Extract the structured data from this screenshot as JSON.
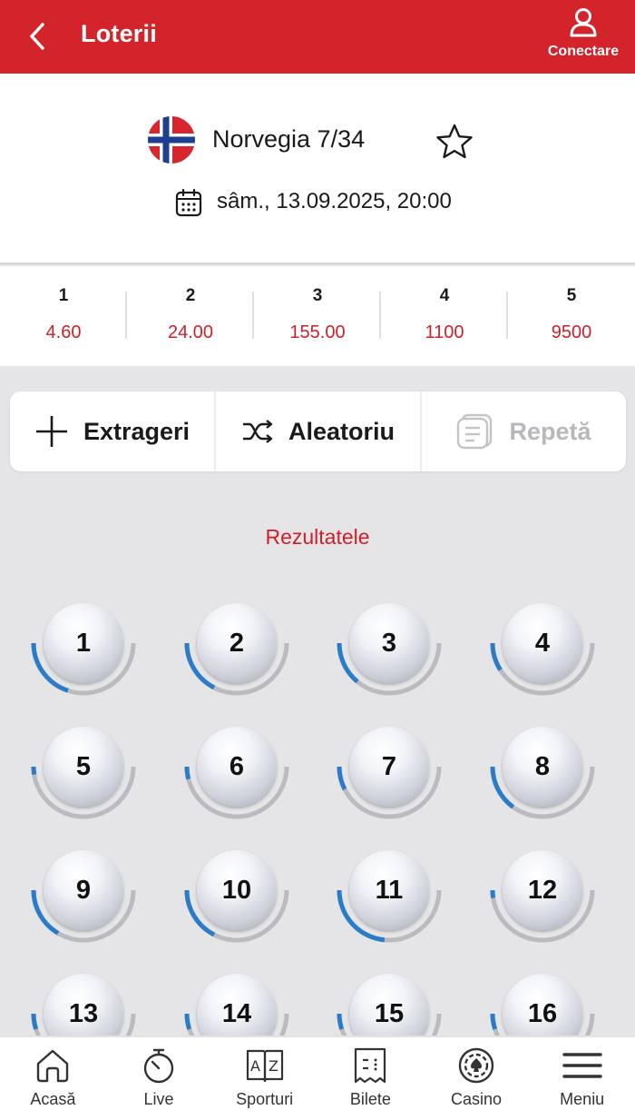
{
  "topbar": {
    "title": "Loterii",
    "login_label": "Conectare"
  },
  "lottery": {
    "name": "Norvegia 7/34",
    "draw_datetime": "sâm., 13.09.2025, 20:00"
  },
  "odds": [
    {
      "hits": "1",
      "value": "4.60"
    },
    {
      "hits": "2",
      "value": "24.00"
    },
    {
      "hits": "3",
      "value": "155.00"
    },
    {
      "hits": "4",
      "value": "1100"
    },
    {
      "hits": "5",
      "value": "9500"
    }
  ],
  "actions": {
    "draws": "Extrageri",
    "random": "Aleatoriu",
    "repeat": "Repetă"
  },
  "results_label": "Rezultatele",
  "balls": [
    {
      "number": "1",
      "frequency": 0.4
    },
    {
      "number": "2",
      "frequency": 0.35
    },
    {
      "number": "3",
      "frequency": 0.28
    },
    {
      "number": "4",
      "frequency": 0.18
    },
    {
      "number": "5",
      "frequency": 0.05
    },
    {
      "number": "6",
      "frequency": 0.08
    },
    {
      "number": "7",
      "frequency": 0.15
    },
    {
      "number": "8",
      "frequency": 0.3
    },
    {
      "number": "9",
      "frequency": 0.33
    },
    {
      "number": "10",
      "frequency": 0.35
    },
    {
      "number": "11",
      "frequency": 0.47
    },
    {
      "number": "12",
      "frequency": 0.05
    },
    {
      "number": "13",
      "frequency": 0.1
    },
    {
      "number": "14",
      "frequency": 0.1
    },
    {
      "number": "15",
      "frequency": 0.1
    },
    {
      "number": "16",
      "frequency": 0.1
    }
  ],
  "nav": [
    {
      "label": "Acasă",
      "icon": "home-icon"
    },
    {
      "label": "Live",
      "icon": "stopwatch-icon"
    },
    {
      "label": "Sporturi",
      "icon": "az-book-icon"
    },
    {
      "label": "Bilete",
      "icon": "ticket-icon"
    },
    {
      "label": "Casino",
      "icon": "casino-chip-icon"
    },
    {
      "label": "Meniu",
      "icon": "hamburger-icon"
    }
  ],
  "colors": {
    "brand_red": "#d3242b",
    "accent_blue": "#2a7cc7",
    "odds_red": "#cf1f28"
  }
}
